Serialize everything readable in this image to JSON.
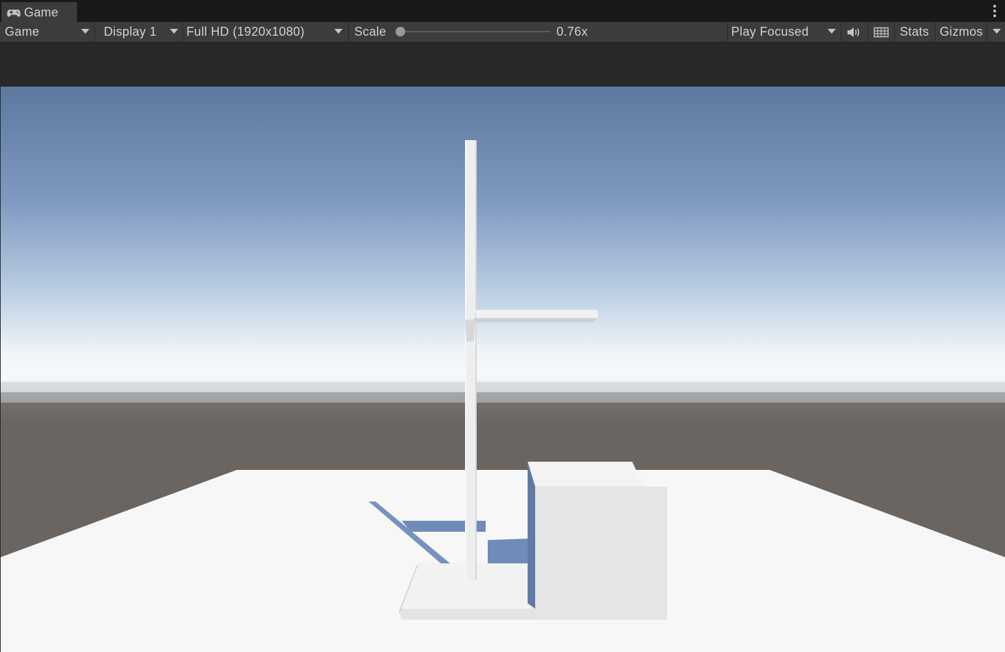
{
  "tab": {
    "title": "Game",
    "icon": "gamepad-icon"
  },
  "toolbar": {
    "view_mode": "Game",
    "display": "Display 1",
    "resolution": "Full HD (1920x1080)",
    "scale_label": "Scale",
    "scale_value": "0.76x",
    "scale_fraction": 0.0,
    "play_mode": "Play Focused",
    "audio_icon": "speaker-icon",
    "shortcuts_icon": "keyboard-icon",
    "stats_label": "Stats",
    "gizmos_label": "Gizmos"
  },
  "colors": {
    "editor_dark": "#191919",
    "toolbar": "#3c3c3c",
    "sky_top": "#5e79a0",
    "sky_horizon": "#f4f8fb",
    "ground": "#6b6561",
    "plane": "#f7f7f7",
    "shadow": "#6f8cb8"
  }
}
